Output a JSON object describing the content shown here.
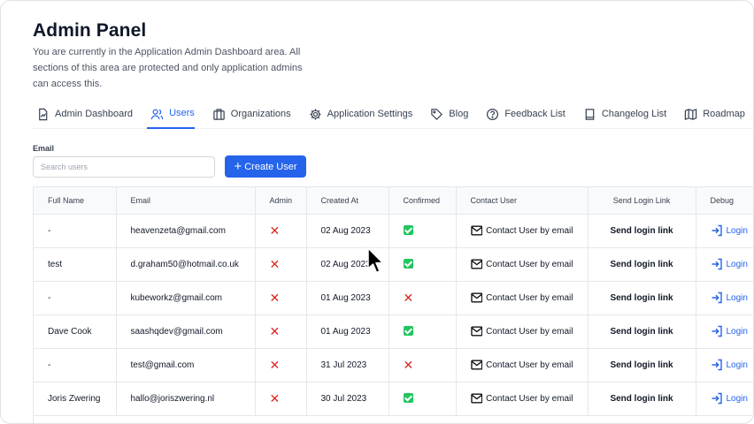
{
  "header": {
    "title": "Admin Panel",
    "description": "You are currently in the Application Admin Dashboard area. All sections of this area are protected and only application admins can access this."
  },
  "tabs": [
    {
      "label": "Admin Dashboard",
      "icon": "chart-file-icon",
      "active": false
    },
    {
      "label": "Users",
      "icon": "users-icon",
      "active": true
    },
    {
      "label": "Organizations",
      "icon": "building-icon",
      "active": false
    },
    {
      "label": "Application Settings",
      "icon": "gear-icon",
      "active": false
    },
    {
      "label": "Blog",
      "icon": "tag-icon",
      "active": false
    },
    {
      "label": "Feedback List",
      "icon": "question-circle-icon",
      "active": false
    },
    {
      "label": "Changelog List",
      "icon": "book-icon",
      "active": false
    },
    {
      "label": "Roadmap",
      "icon": "map-icon",
      "active": false
    }
  ],
  "filter": {
    "label": "Email",
    "placeholder": "Search users",
    "create_label": "Create User"
  },
  "table": {
    "columns": [
      "Full Name",
      "Email",
      "Admin",
      "Created At",
      "Confirmed",
      "Contact User",
      "Send Login Link",
      "Debug"
    ],
    "contact_label": "Contact User by email",
    "send_label": "Send login link",
    "login_label": "Login",
    "rows": [
      {
        "name": "-",
        "email": "heavenzeta@gmail.com",
        "admin": false,
        "created": "02 Aug 2023",
        "confirmed": true
      },
      {
        "name": "test",
        "email": "d.graham50@hotmail.co.uk",
        "admin": false,
        "created": "02 Aug 2023",
        "confirmed": true
      },
      {
        "name": "-",
        "email": "kubeworkz@gmail.com",
        "admin": false,
        "created": "01 Aug 2023",
        "confirmed": false
      },
      {
        "name": "Dave Cook",
        "email": "saashqdev@gmail.com",
        "admin": false,
        "created": "01 Aug 2023",
        "confirmed": true
      },
      {
        "name": "-",
        "email": "test@gmail.com",
        "admin": false,
        "created": "31 Jul 2023",
        "confirmed": false
      },
      {
        "name": "Joris Zwering",
        "email": "hallo@joriszwering.nl",
        "admin": false,
        "created": "30 Jul 2023",
        "confirmed": true
      }
    ]
  },
  "colors": {
    "accent": "#2563eb",
    "danger": "#dc2626",
    "success": "#22c55e"
  }
}
